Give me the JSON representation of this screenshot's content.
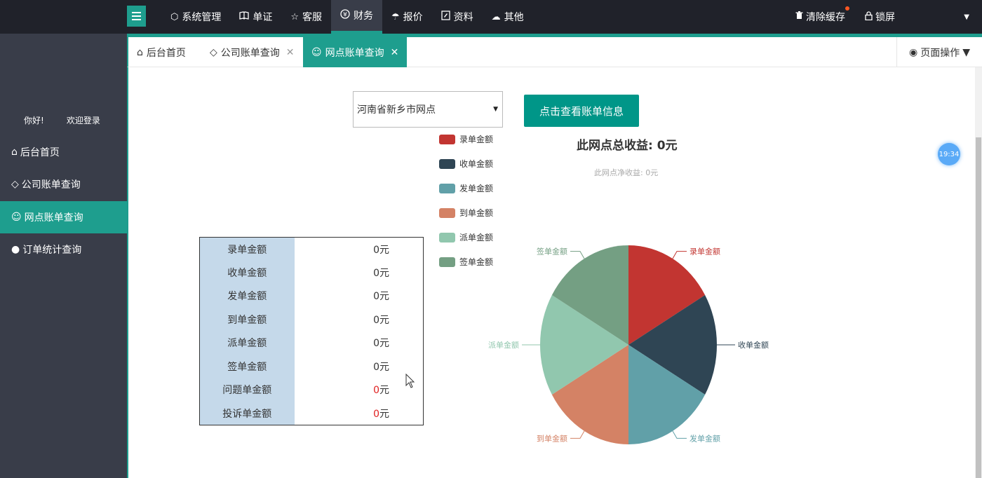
{
  "topbar": {
    "nav": [
      {
        "label": "系统管理",
        "icon": "cube-icon",
        "glyph": "⬡"
      },
      {
        "label": "单证",
        "icon": "book-icon",
        "glyph": "📖"
      },
      {
        "label": "客服",
        "icon": "star-icon",
        "glyph": "☆"
      },
      {
        "label": "财务",
        "icon": "yen-icon",
        "glyph": "¥"
      },
      {
        "label": "报价",
        "icon": "umbrella-icon",
        "glyph": "☂"
      },
      {
        "label": "资料",
        "icon": "document-icon",
        "glyph": "✎"
      },
      {
        "label": "其他",
        "icon": "cloud-icon",
        "glyph": "☁"
      }
    ],
    "active_nav": "财务",
    "clear_cache": "清除缓存",
    "lock_screen": "锁屏"
  },
  "sidebar": {
    "greeting": "你好!",
    "welcome": "欢迎登录",
    "items": [
      {
        "label": "后台首页",
        "icon": "home-icon",
        "glyph": "⌂"
      },
      {
        "label": "公司账单查询",
        "icon": "diamond-icon",
        "glyph": "◇"
      },
      {
        "label": "网点账单查询",
        "icon": "smile-icon",
        "glyph": "☺"
      },
      {
        "label": "订单统计查询",
        "icon": "circle-icon",
        "glyph": "●"
      }
    ]
  },
  "tabs": [
    {
      "label": "后台首页",
      "glyph": "⌂"
    },
    {
      "label": "公司账单查询",
      "glyph": "◇"
    },
    {
      "label": "网点账单查询",
      "glyph": "☺"
    }
  ],
  "page_ops": "页面操作",
  "select": {
    "value": "河南省新乡市网点"
  },
  "query_button": "点击查看账单信息",
  "summary": {
    "total_label": "此网点总收益:",
    "total_value": "0元",
    "net_label": "此网点净收益:",
    "net_value": "0元"
  },
  "table": [
    {
      "label": "录单金额",
      "value": "0元",
      "red": false
    },
    {
      "label": "收单金额",
      "value": "0元",
      "red": false
    },
    {
      "label": "发单金额",
      "value": "0元",
      "red": false
    },
    {
      "label": "到单金额",
      "value": "0元",
      "red": false
    },
    {
      "label": "派单金额",
      "value": "0元",
      "red": false
    },
    {
      "label": "签单金额",
      "value": "0元",
      "red": false
    },
    {
      "label": "问题单金额",
      "value_num": "0",
      "unit": "元",
      "red": true
    },
    {
      "label": "投诉单金额",
      "value_num": "0",
      "unit": "元",
      "red": true
    }
  ],
  "clock": "19:34",
  "chart_data": {
    "type": "pie",
    "categories": [
      "录单金额",
      "收单金额",
      "发单金额",
      "到单金额",
      "派单金额",
      "签单金额"
    ],
    "values": [
      1,
      1,
      1,
      1,
      1,
      1
    ],
    "colors": [
      "#c23531",
      "#2f4554",
      "#61a0a8",
      "#d48265",
      "#91c7ae",
      "#749f83"
    ],
    "legend_position": "left"
  }
}
